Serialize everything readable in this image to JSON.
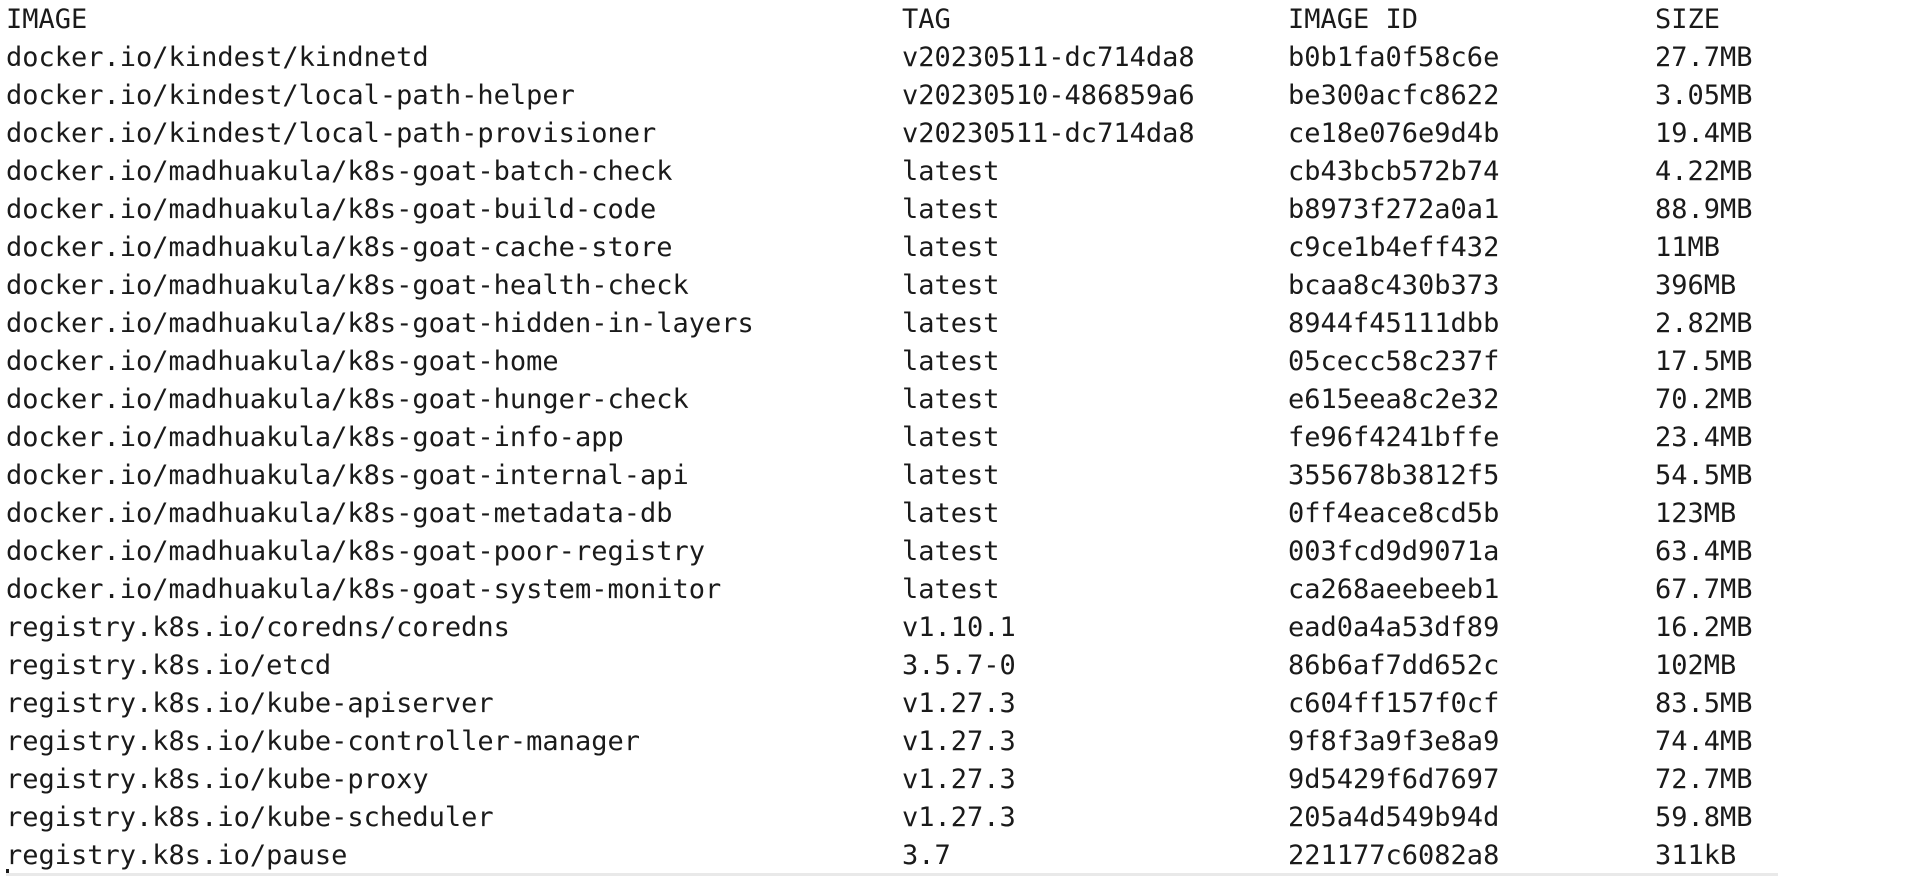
{
  "header": {
    "image": "IMAGE",
    "tag": "TAG",
    "image_id": "IMAGE ID",
    "size": "SIZE"
  },
  "rows": [
    {
      "image": "docker.io/kindest/kindnetd",
      "tag": "v20230511-dc714da8",
      "image_id": "b0b1fa0f58c6e",
      "size": "27.7MB"
    },
    {
      "image": "docker.io/kindest/local-path-helper",
      "tag": "v20230510-486859a6",
      "image_id": "be300acfc8622",
      "size": "3.05MB"
    },
    {
      "image": "docker.io/kindest/local-path-provisioner",
      "tag": "v20230511-dc714da8",
      "image_id": "ce18e076e9d4b",
      "size": "19.4MB"
    },
    {
      "image": "docker.io/madhuakula/k8s-goat-batch-check",
      "tag": "latest",
      "image_id": "cb43bcb572b74",
      "size": "4.22MB"
    },
    {
      "image": "docker.io/madhuakula/k8s-goat-build-code",
      "tag": "latest",
      "image_id": "b8973f272a0a1",
      "size": "88.9MB"
    },
    {
      "image": "docker.io/madhuakula/k8s-goat-cache-store",
      "tag": "latest",
      "image_id": "c9ce1b4eff432",
      "size": "11MB"
    },
    {
      "image": "docker.io/madhuakula/k8s-goat-health-check",
      "tag": "latest",
      "image_id": "bcaa8c430b373",
      "size": "396MB"
    },
    {
      "image": "docker.io/madhuakula/k8s-goat-hidden-in-layers",
      "tag": "latest",
      "image_id": "8944f45111dbb",
      "size": "2.82MB"
    },
    {
      "image": "docker.io/madhuakula/k8s-goat-home",
      "tag": "latest",
      "image_id": "05cecc58c237f",
      "size": "17.5MB"
    },
    {
      "image": "docker.io/madhuakula/k8s-goat-hunger-check",
      "tag": "latest",
      "image_id": "e615eea8c2e32",
      "size": "70.2MB"
    },
    {
      "image": "docker.io/madhuakula/k8s-goat-info-app",
      "tag": "latest",
      "image_id": "fe96f4241bffe",
      "size": "23.4MB"
    },
    {
      "image": "docker.io/madhuakula/k8s-goat-internal-api",
      "tag": "latest",
      "image_id": "355678b3812f5",
      "size": "54.5MB"
    },
    {
      "image": "docker.io/madhuakula/k8s-goat-metadata-db",
      "tag": "latest",
      "image_id": "0ff4eace8cd5b",
      "size": "123MB"
    },
    {
      "image": "docker.io/madhuakula/k8s-goat-poor-registry",
      "tag": "latest",
      "image_id": "003fcd9d9071a",
      "size": "63.4MB"
    },
    {
      "image": "docker.io/madhuakula/k8s-goat-system-monitor",
      "tag": "latest",
      "image_id": "ca268aeebeeb1",
      "size": "67.7MB"
    },
    {
      "image": "registry.k8s.io/coredns/coredns",
      "tag": "v1.10.1",
      "image_id": "ead0a4a53df89",
      "size": "16.2MB"
    },
    {
      "image": "registry.k8s.io/etcd",
      "tag": "3.5.7-0",
      "image_id": "86b6af7dd652c",
      "size": "102MB"
    },
    {
      "image": "registry.k8s.io/kube-apiserver",
      "tag": "v1.27.3",
      "image_id": "c604ff157f0cf",
      "size": "83.5MB"
    },
    {
      "image": "registry.k8s.io/kube-controller-manager",
      "tag": "v1.27.3",
      "image_id": "9f8f3a9f3e8a9",
      "size": "74.4MB"
    },
    {
      "image": "registry.k8s.io/kube-proxy",
      "tag": "v1.27.3",
      "image_id": "9d5429f6d7697",
      "size": "72.7MB"
    },
    {
      "image": "registry.k8s.io/kube-scheduler",
      "tag": "v1.27.3",
      "image_id": "205a4d549b94d",
      "size": "59.8MB"
    },
    {
      "image": "registry.k8s.io/pause",
      "tag": "3.7",
      "image_id": "221177c6082a8",
      "size": "311kB"
    }
  ]
}
